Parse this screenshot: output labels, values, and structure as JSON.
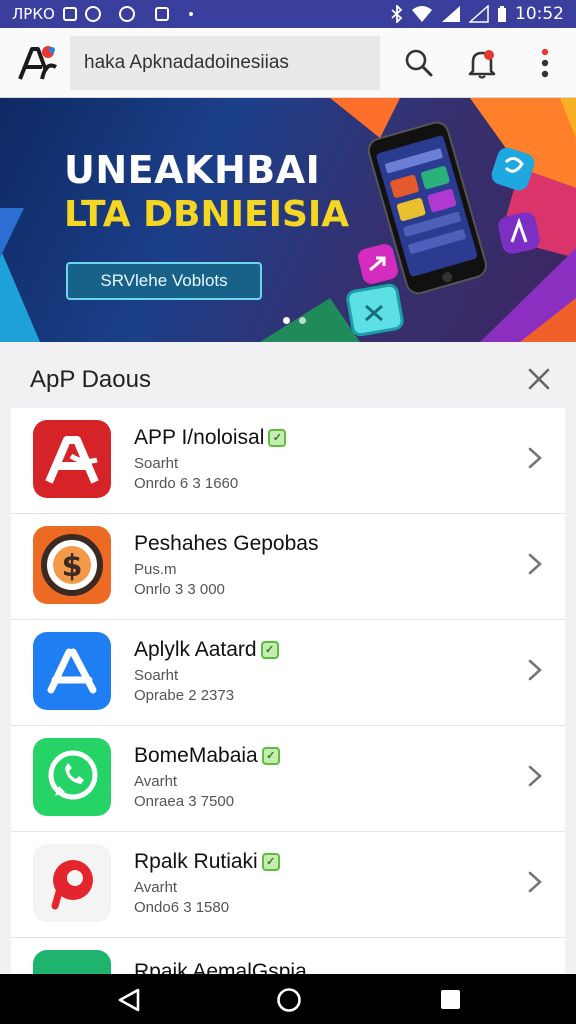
{
  "status_bar": {
    "left_text": "ЛРКО",
    "time": "10:52",
    "icons": [
      "photo-icon",
      "settings-icon",
      "chrome-icon",
      "image-icon",
      "dot-icon",
      "bluetooth-icon",
      "wifi-icon",
      "signal-icon",
      "battery-icon"
    ]
  },
  "app_bar": {
    "search_value": "haka Apknadadoinesiias",
    "icons": [
      "app-logo",
      "search-icon",
      "notification-bell-icon",
      "more-vert-icon"
    ],
    "accent": "#e53935"
  },
  "banner": {
    "title": "UNEAKНBAI",
    "subtitle": "LTA DBNIEISIA",
    "cta_label": "SRVlehe Voblots",
    "page_indicator": {
      "count": 2,
      "active": 1
    }
  },
  "section": {
    "title": "ApP Daous"
  },
  "apps": [
    {
      "name": "APP I/noloisal",
      "category": "Soarht",
      "downloads": "Onrdo 6 3 1660",
      "icon": "adobe-acrobat-icon",
      "icon_color": "#d62327",
      "verified": true
    },
    {
      "name": "Peshahes Gepobas",
      "category": "Pus.m",
      "downloads": "Onrlo 3 3 000",
      "icon": "dollar-coin-icon",
      "icon_color": "#ec6a23",
      "verified": false
    },
    {
      "name": "Aplylk Aatard",
      "category": "Soarht",
      "downloads": "Oprabe 2 2373",
      "icon": "app-store-icon",
      "icon_color": "#1f7ef1",
      "verified": true
    },
    {
      "name": "BomeMabaia",
      "category": "Avarht",
      "downloads": "Onraea 3 7500",
      "icon": "whatsapp-icon",
      "icon_color": "#25d366",
      "verified": true
    },
    {
      "name": "Rpalk Rutiaki",
      "category": "Avarht",
      "downloads": "Ondo6 3 1580",
      "icon": "pinterest-icon",
      "icon_color": "#e3262d",
      "verified": true
    },
    {
      "name": "Rpaik AemalGspia",
      "category": "",
      "downloads": "",
      "icon": "app-icon",
      "icon_color": "#1fb46e",
      "verified": false
    }
  ],
  "nav_bar": {
    "icons": [
      "back-icon",
      "home-icon",
      "recents-icon"
    ]
  }
}
